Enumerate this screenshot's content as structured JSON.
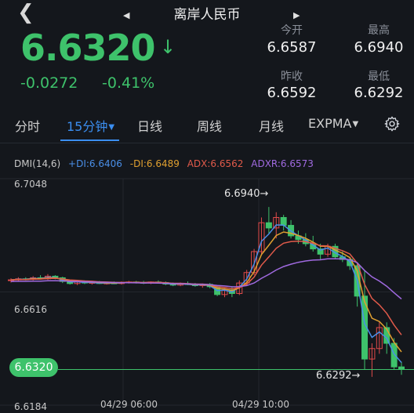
{
  "header": {
    "title": "离岸人民币",
    "back_icon": "chevron-left-icon",
    "prev_icon": "triangle-left-icon",
    "next_icon": "triangle-right-icon"
  },
  "quote": {
    "price": "6.6320",
    "direction_icon": "down-arrow-icon",
    "change": "-0.0272",
    "change_pct": "-0.41%",
    "color": "#3ec26b",
    "stats": {
      "open_label": "今开",
      "open": "6.6587",
      "high_label": "最高",
      "high": "6.6940",
      "prev_close_label": "昨收",
      "prev_close": "6.6592",
      "low_label": "最低",
      "low": "6.6292"
    }
  },
  "tabs": [
    {
      "label": "分时"
    },
    {
      "label": "15分钟",
      "active": true
    },
    {
      "label": "日线"
    },
    {
      "label": "周线"
    },
    {
      "label": "月线"
    },
    {
      "label": "EXPMA"
    }
  ],
  "settings_icon": "gear-icon",
  "indicator": {
    "name": "DMI(14,6)",
    "pdi": "+DI:6.6406",
    "mdi": "-DI:6.6489",
    "adx": "ADX:6.6562",
    "adxr": "ADXR:6.6573",
    "colors": {
      "pdi": "#4a8fe8",
      "mdi": "#e0a030",
      "adx": "#e05a4a",
      "adxr": "#a06ae0"
    }
  },
  "chart": {
    "y_top": "6.7048",
    "y_mid": "6.6616",
    "y_bottom": "6.6184",
    "x_labels": [
      "04/29 06:00",
      "04/29 10:00"
    ],
    "current_price": "6.6320",
    "high_annot": "6.6940",
    "low_annot": "6.6292"
  },
  "chart_data": {
    "type": "candlestick",
    "ylim": [
      6.6184,
      6.7048
    ],
    "x_labels": [
      "04/29 06:00",
      "04/29 10:00"
    ],
    "current_price": 6.632,
    "high": 6.694,
    "low": 6.6292,
    "candles": [
      [
        6.666,
        6.6668,
        6.6652,
        6.6662
      ],
      [
        6.6662,
        6.6672,
        6.6655,
        6.6666
      ],
      [
        6.6666,
        6.6672,
        6.666,
        6.6664
      ],
      [
        6.6664,
        6.6676,
        6.666,
        6.667
      ],
      [
        6.667,
        6.668,
        6.6664,
        6.6666
      ],
      [
        6.6666,
        6.6684,
        6.6662,
        6.6676
      ],
      [
        6.6676,
        6.668,
        6.6664,
        6.667
      ],
      [
        6.667,
        6.6674,
        6.665,
        6.6656
      ],
      [
        6.6656,
        6.6662,
        6.6644,
        6.6648
      ],
      [
        6.6648,
        6.666,
        6.6642,
        6.6655
      ],
      [
        6.6655,
        6.666,
        6.6646,
        6.665
      ],
      [
        6.665,
        6.6656,
        6.6644,
        6.6652
      ],
      [
        6.6652,
        6.6658,
        6.6646,
        6.6648
      ],
      [
        6.6648,
        6.6654,
        6.6644,
        6.665
      ],
      [
        6.665,
        6.6656,
        6.6646,
        6.6648
      ],
      [
        6.6648,
        6.6656,
        6.6644,
        6.6652
      ],
      [
        6.6652,
        6.6658,
        6.6648,
        6.6654
      ],
      [
        6.6654,
        6.6658,
        6.6648,
        6.6652
      ],
      [
        6.6652,
        6.6658,
        6.6646,
        6.665
      ],
      [
        6.665,
        6.6656,
        6.6646,
        6.6654
      ],
      [
        6.6654,
        6.666,
        6.6648,
        6.6652
      ],
      [
        6.6652,
        6.6656,
        6.6642,
        6.6646
      ],
      [
        6.6646,
        6.6652,
        6.6638,
        6.6642
      ],
      [
        6.6642,
        6.6652,
        6.6638,
        6.6648
      ],
      [
        6.6648,
        6.6656,
        6.6642,
        6.6644
      ],
      [
        6.6644,
        6.665,
        6.6636,
        6.664
      ],
      [
        6.664,
        6.6648,
        6.6632,
        6.6645
      ],
      [
        6.6645,
        6.665,
        6.663,
        6.6636
      ],
      [
        6.6636,
        6.664,
        6.66,
        6.6606
      ],
      [
        6.6606,
        6.663,
        6.6596,
        6.6624
      ],
      [
        6.6624,
        6.6636,
        6.6596,
        6.661
      ],
      [
        6.661,
        6.666,
        6.6604,
        6.665
      ],
      [
        6.665,
        6.67,
        6.664,
        6.669
      ],
      [
        6.669,
        6.678,
        6.668,
        6.677
      ],
      [
        6.677,
        6.69,
        6.676,
        6.688
      ],
      [
        6.688,
        6.694,
        6.684,
        6.686
      ],
      [
        6.686,
        6.692,
        6.682,
        6.69
      ],
      [
        6.69,
        6.691,
        6.685,
        6.687
      ],
      [
        6.687,
        6.689,
        6.682,
        6.683
      ],
      [
        6.683,
        6.685,
        6.68,
        6.6816
      ],
      [
        6.6816,
        6.684,
        6.679,
        6.68
      ],
      [
        6.68,
        6.683,
        6.677,
        6.678
      ],
      [
        6.678,
        6.68,
        6.674,
        6.676
      ],
      [
        6.676,
        6.68,
        6.675,
        6.679
      ],
      [
        6.679,
        6.68,
        6.674,
        6.675
      ],
      [
        6.675,
        6.677,
        6.673,
        6.674
      ],
      [
        6.674,
        6.675,
        6.67,
        6.6716
      ],
      [
        6.6716,
        6.673,
        6.656,
        6.66
      ],
      [
        6.66,
        6.67,
        6.632,
        6.636
      ],
      [
        6.636,
        6.642,
        6.6292,
        6.64
      ],
      [
        6.64,
        6.65,
        6.638,
        6.648
      ],
      [
        6.648,
        6.65,
        6.638,
        6.642
      ],
      [
        6.642,
        6.644,
        6.632,
        6.633
      ],
      [
        6.633,
        6.635,
        6.63,
        6.632
      ]
    ]
  }
}
